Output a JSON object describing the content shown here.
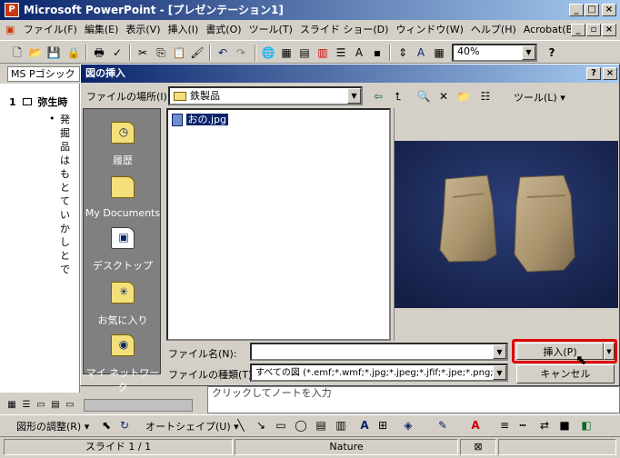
{
  "app": {
    "title": "Microsoft PowerPoint - [プレゼンテーション1]",
    "icon_letter": "P"
  },
  "menu": [
    "ファイル(F)",
    "編集(E)",
    "表示(V)",
    "挿入(I)",
    "書式(O)",
    "ツール(T)",
    "スライド ショー(D)",
    "ウィンドウ(W)",
    "ヘルプ(H)",
    "Acrobat(B)"
  ],
  "toolbar": {
    "zoom": "40%",
    "help_glyph": "?"
  },
  "font": {
    "name": "MS Pゴシック"
  },
  "outline": {
    "slide_number": "1",
    "slide_title": "弥生時",
    "bullet_lines": [
      "発掘",
      "品は",
      "もと",
      "てい",
      "かし",
      "とで"
    ]
  },
  "dialog": {
    "title": "図の挿入",
    "location_label": "ファイルの場所(I):",
    "location_value": "鉄製品",
    "tools_label": "ツール(L)",
    "places": [
      "履歴",
      "My Documents",
      "デスクトップ",
      "お気に入り",
      "マイ ネットワーク"
    ],
    "files": [
      "おの.jpg"
    ],
    "filename_label": "ファイル名(N):",
    "filename_value": "",
    "filetype_label": "ファイルの種類(T):",
    "filetype_value": "すべての図 (*.emf;*.wmf;*.jpg;*.jpeg;*.jfif;*.jpe;*.png;*.b",
    "insert_label": "挿入(P)",
    "cancel_label": "キャンセル",
    "highlight_color": "#e00000"
  },
  "notes": {
    "placeholder": "クリックしてノートを入力"
  },
  "drawing": {
    "adjust_label": "図形の調整(R)",
    "autoshape_label": "オートシェイプ(U)"
  },
  "status": {
    "slide": "スライド 1 / 1",
    "design": "Nature"
  }
}
